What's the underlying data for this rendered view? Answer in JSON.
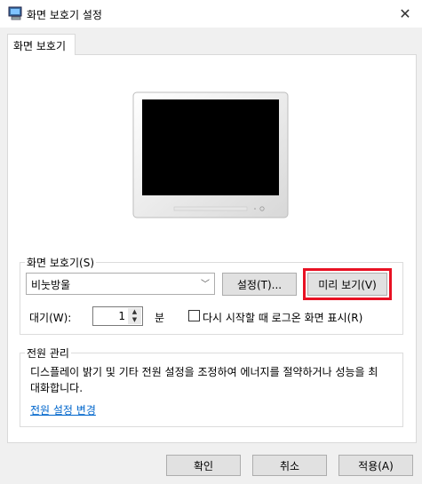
{
  "window": {
    "title": "화면 보호기 설정",
    "close_glyph": "✕"
  },
  "tab": {
    "label": "화면 보호기"
  },
  "screensaver": {
    "group_label": "화면 보호기(S)",
    "selected": "비눗방울",
    "settings_button": "설정(T)...",
    "preview_button": "미리 보기(V)",
    "wait_label": "대기(W):",
    "wait_value": "1",
    "wait_unit": "분",
    "resume_logon_label": "다시 시작할 때 로그온 화면 표시(R)",
    "resume_logon_checked": false
  },
  "power": {
    "group_label": "전원 관리",
    "description": "디스플레이 밝기 및 기타 전원 설정을 조정하여 에너지를 절약하거나 성능을 최대화합니다.",
    "link": "전원 설정 변경"
  },
  "footer": {
    "ok": "확인",
    "cancel": "취소",
    "apply": "적용(A)"
  },
  "colors": {
    "highlight": "#e81123",
    "link": "#0066cc"
  }
}
